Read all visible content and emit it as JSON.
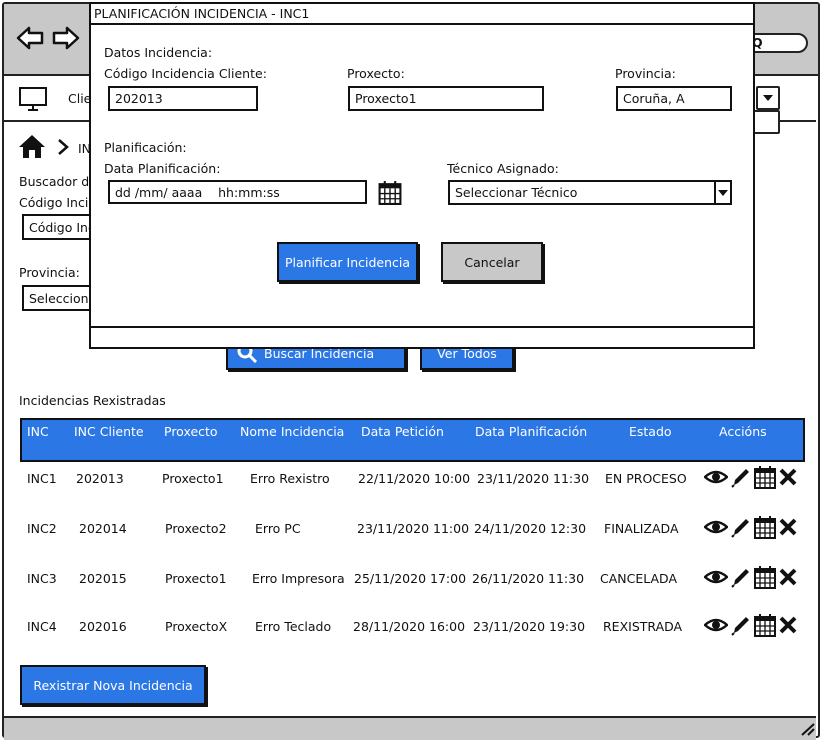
{
  "background": {
    "client_label": "Clie",
    "breadcrumb_partial": "IN",
    "search_title_partial": "Buscador d",
    "code_label_partial": "Código Inci",
    "code_input_partial": "Código Inc",
    "province_label": "Provincia:",
    "province_select_partial": "Seleccion",
    "search_button": "Buscar Incidencia",
    "view_all_button": "Ver Todos"
  },
  "table": {
    "section_title": "Incidencias Rexistradas",
    "columns": [
      "INC",
      "INC Cliente",
      "Proxecto",
      "Nome Incidencia",
      "Data Petición",
      "Data Planificación",
      "Estado",
      "Accións"
    ],
    "rows": [
      {
        "inc": "INC1",
        "cliente": "202013",
        "proxecto": "Proxecto1",
        "nome": "Erro Rexistro",
        "peticion": "22/11/2020 10:00",
        "planificacion": "23/11/2020 11:30",
        "estado": "EN  PROCESO"
      },
      {
        "inc": "INC2",
        "cliente": "202014",
        "proxecto": "Proxecto2",
        "nome": "Erro PC",
        "peticion": "23/11/2020 11:00",
        "planificacion": "24/11/2020 12:30",
        "estado": "FINALIZADA"
      },
      {
        "inc": "INC3",
        "cliente": "202015",
        "proxecto": "Proxecto1",
        "nome": "Erro Impresora",
        "peticion": "25/11/2020 17:00",
        "planificacion": "26/11/2020 11:30",
        "estado": "CANCELADA"
      },
      {
        "inc": "INC4",
        "cliente": "202016",
        "proxecto": "ProxectoX",
        "nome": "Erro Teclado",
        "peticion": "28/11/2020 16:00",
        "planificacion": "23/11/2020 19:30",
        "estado": "REXISTRADA"
      }
    ]
  },
  "register_button": "Rexistrar Nova Incidencia",
  "modal": {
    "title": "PLANIFICACIÓN INCIDENCIA - INC1",
    "section_incidencia": "Datos Incidencia:",
    "code_label": "Código Incidencia Cliente:",
    "code_value": "202013",
    "project_label": "Proxecto:",
    "project_value": "Proxecto1",
    "province_label": "Provincia:",
    "province_value": "Coruña, A",
    "section_planificacion": "Planificación:",
    "date_label": "Data Planificación:",
    "date_value": "dd /mm/ aaaa    hh:mm:ss",
    "tech_label": "Técnico Asignado:",
    "tech_value": "Seleccionar Técnico",
    "plan_button": "Planificar Incidencia",
    "cancel_button": "Cancelar"
  },
  "icons": {
    "back": "arrow-left-icon",
    "forward": "arrow-right-icon",
    "home": "home-icon",
    "monitor": "monitor-icon",
    "search": "search-icon",
    "calendar": "calendar-icon",
    "view": "eye-icon",
    "edit": "pencil-icon",
    "plan": "calendar-icon",
    "delete": "close-icon",
    "resize": "resize-grip-icon"
  },
  "colors": {
    "accent": "#2b77e6",
    "chrome": "#c8c8c8"
  }
}
